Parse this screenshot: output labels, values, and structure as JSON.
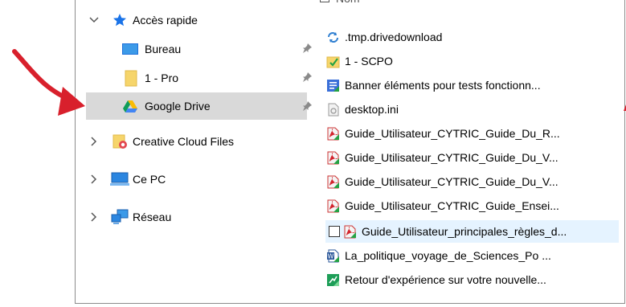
{
  "nav": {
    "quick_access": "Accès rapide",
    "items": [
      {
        "label": "Bureau"
      },
      {
        "label": "1 - Pro"
      },
      {
        "label": "Google Drive"
      }
    ],
    "creative_cloud": "Creative Cloud Files",
    "this_pc": "Ce PC",
    "network": "Réseau"
  },
  "files": [
    {
      "name": ".tmp.drivedownload",
      "icon": "sync-folder-icon"
    },
    {
      "name": "1 - SCPO",
      "icon": "folder-check-icon"
    },
    {
      "name": "Banner éléments pour tests fonctionn...",
      "icon": "form-doc-icon"
    },
    {
      "name": "desktop.ini",
      "icon": "ini-file-icon"
    },
    {
      "name": "Guide_Utilisateur_CYTRIC_Guide_Du_R...",
      "icon": "pdf-synced-icon"
    },
    {
      "name": "Guide_Utilisateur_CYTRIC_Guide_Du_V...",
      "icon": "pdf-synced-icon"
    },
    {
      "name": "Guide_Utilisateur_CYTRIC_Guide_Du_V...",
      "icon": "pdf-synced-icon"
    },
    {
      "name": "Guide_Utilisateur_CYTRIC_Guide_Ensei...",
      "icon": "pdf-synced-icon"
    },
    {
      "name": "Guide_Utilisateur_principales_règles_d...",
      "icon": "pdf-synced-icon"
    },
    {
      "name": "La_politique_voyage_de_Sciences_Po ...",
      "icon": "word-doc-icon"
    },
    {
      "name": "Retour d'expérience sur votre nouvelle...",
      "icon": "sheet-doc-icon"
    }
  ],
  "colors": {
    "annotation_arrow": "#d8202c",
    "selection": "#d9d9d9",
    "hover": "#e5f3ff"
  }
}
